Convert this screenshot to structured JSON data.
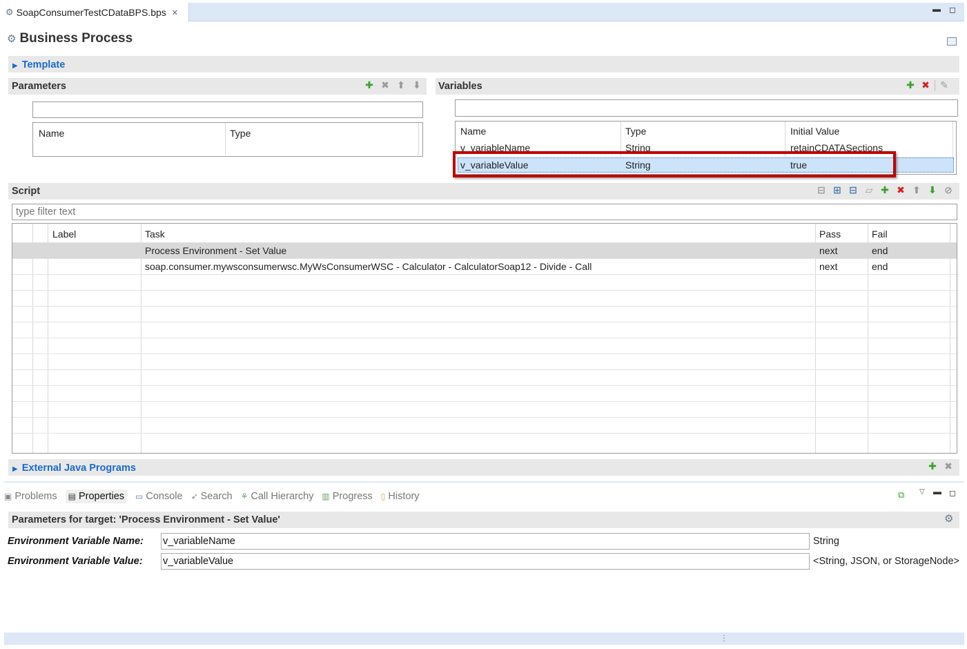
{
  "editor": {
    "tab_label": "SoapConsumerTestCDataBPS.bps",
    "close_glyph": "✕",
    "min_glyph": "▬",
    "max_glyph": "◻"
  },
  "page_title": "Business Process",
  "template_section": "Template",
  "parameters": {
    "title": "Parameters",
    "filter_value": "",
    "columns": [
      "Name",
      "Type"
    ]
  },
  "variables": {
    "title": "Variables",
    "filter_value": "",
    "columns": [
      "Name",
      "Type",
      "Initial Value"
    ],
    "rows": [
      {
        "name": "v_variableName",
        "type": "String",
        "initial": "retainCDATASections"
      },
      {
        "name": "v_variableValue",
        "type": "String",
        "initial": "true"
      }
    ],
    "selected_row": 1,
    "highlight_color": "#c00000"
  },
  "script": {
    "title": "Script",
    "filter_placeholder": "type filter text",
    "columns": [
      "Label",
      "Task",
      "Pass",
      "Fail"
    ],
    "rows": [
      {
        "label": "",
        "task": "Process Environment - Set Value",
        "pass": "next",
        "fail": "end"
      },
      {
        "label": "",
        "task": "soap.consumer.mywsconsumerwsc.MyWsConsumerWSC - Calculator - CalculatorSoap12 - Divide - Call",
        "pass": "next",
        "fail": "end"
      }
    ]
  },
  "external_java": "External Java Programs",
  "bottom_tabs": [
    {
      "label": "Problems",
      "icon": "problems-icon",
      "glyph": "▣"
    },
    {
      "label": "Properties",
      "icon": "properties-icon",
      "glyph": "▤"
    },
    {
      "label": "Console",
      "icon": "console-icon",
      "glyph": "▭"
    },
    {
      "label": "Search",
      "icon": "search-icon",
      "glyph": "➶"
    },
    {
      "label": "Call Hierarchy",
      "icon": "call-hierarchy-icon",
      "glyph": "⚘"
    },
    {
      "label": "Progress",
      "icon": "progress-icon",
      "glyph": "▥"
    },
    {
      "label": "History",
      "icon": "history-icon",
      "glyph": "▯"
    }
  ],
  "active_bottom_tab": "Properties",
  "properties": {
    "title": "Parameters for target: 'Process Environment - Set Value'",
    "fields": [
      {
        "label": "Environment Variable Name:",
        "value": "v_variableName",
        "type": "String"
      },
      {
        "label": "Environment Variable Value:",
        "value": "v_variableValue",
        "type": "<String, JSON, or StorageNode>"
      }
    ]
  }
}
